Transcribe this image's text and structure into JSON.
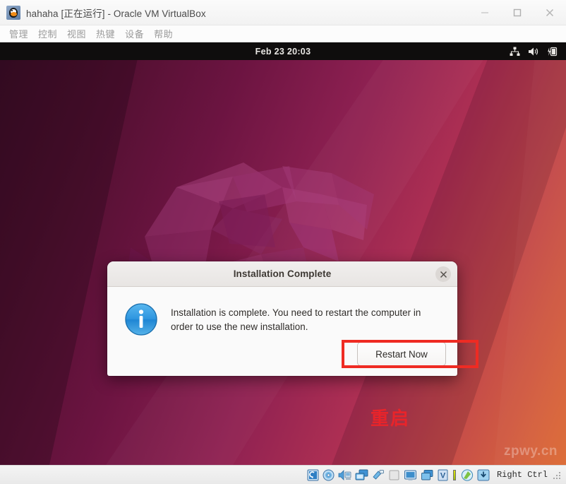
{
  "host_window": {
    "app_icon": "virtualbox-penguin-icon",
    "title": "hahaha [正在运行] - Oracle VM VirtualBox",
    "controls": {
      "minimize": "minimize-icon",
      "maximize": "maximize-icon",
      "close": "close-icon"
    }
  },
  "menubar": {
    "items": [
      {
        "label": "管理"
      },
      {
        "label": "控制"
      },
      {
        "label": "视图"
      },
      {
        "label": "热键"
      },
      {
        "label": "设备"
      },
      {
        "label": "帮助"
      }
    ]
  },
  "guest": {
    "topbar": {
      "clock": "Feb 23  20:03",
      "tray": [
        {
          "name": "network-wired-icon"
        },
        {
          "name": "volume-icon"
        },
        {
          "name": "battery-charging-icon"
        }
      ]
    },
    "wallpaper": {
      "description": "Ubuntu focal fossa origami wallpaper",
      "gradient_start": "#3a0c26",
      "gradient_mid": "#8d2051",
      "gradient_end": "#dd6b35"
    },
    "watermark": "zpwy.cn"
  },
  "dialog": {
    "title": "Installation Complete",
    "close_icon": "close-icon",
    "info_icon": "info-icon",
    "message": "Installation is complete. You need to restart the computer in order to use the new installation.",
    "restart_label": "Restart Now"
  },
  "annotations": {
    "highlight_color": "#ef2b23",
    "label": "重启"
  },
  "statusbar": {
    "icons": [
      {
        "name": "hard-disk-icon"
      },
      {
        "name": "optical-disk-icon"
      },
      {
        "name": "audio-icon"
      },
      {
        "name": "network-icon"
      },
      {
        "name": "usb-icon"
      },
      {
        "name": "shared-folder-icon"
      },
      {
        "name": "display-icon"
      },
      {
        "name": "recording-icon"
      },
      {
        "name": "vm-features-icon"
      },
      {
        "name": "mouse-integration-icon"
      },
      {
        "name": "keyboard-capture-icon"
      }
    ],
    "host_key": "Right Ctrl",
    "resize_grip": "resize-grip-icon"
  }
}
